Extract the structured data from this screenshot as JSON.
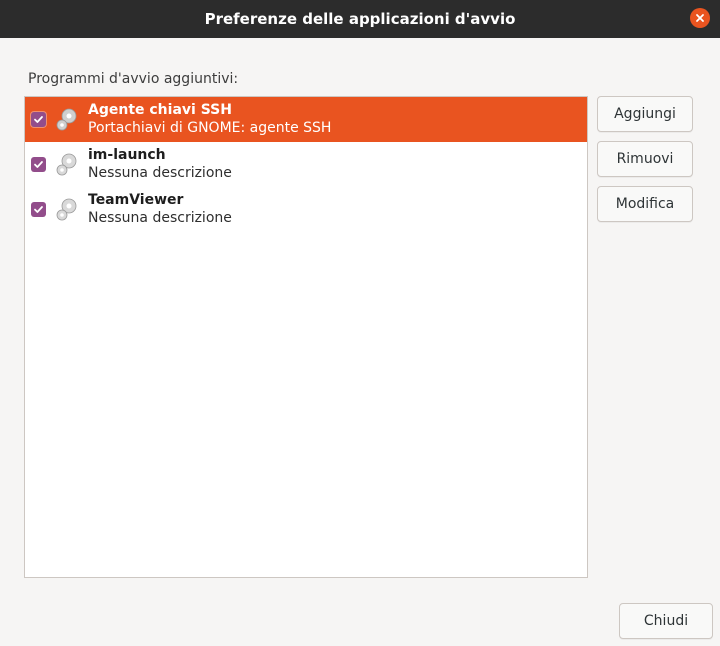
{
  "window": {
    "title": "Preferenze delle applicazioni d'avvio"
  },
  "section_label": "Programmi d'avvio aggiuntivi:",
  "programs": [
    {
      "name": "Agente chiavi SSH",
      "description": "Portachiavi di GNOME: agente SSH",
      "enabled": true,
      "selected": true
    },
    {
      "name": "im-launch",
      "description": "Nessuna descrizione",
      "enabled": true,
      "selected": false
    },
    {
      "name": "TeamViewer",
      "description": "Nessuna descrizione",
      "enabled": true,
      "selected": false
    }
  ],
  "buttons": {
    "add": "Aggiungi",
    "remove": "Rimuovi",
    "edit": "Modifica",
    "close": "Chiudi"
  },
  "colors": {
    "titlebar": "#2c2c2c",
    "accent": "#e95420",
    "checkbox": "#924d8b"
  }
}
